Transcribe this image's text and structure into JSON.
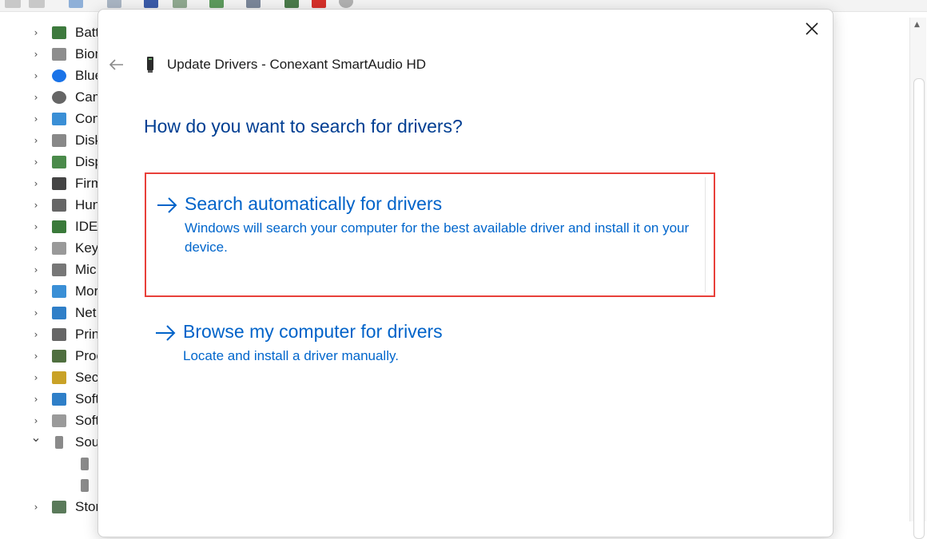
{
  "background": {
    "tree_items": [
      {
        "label": "Batt",
        "icon": "battery-icon",
        "expanded": false
      },
      {
        "label": "Biom",
        "icon": "fingerprint-icon",
        "expanded": false
      },
      {
        "label": "Blue",
        "icon": "bluetooth-icon",
        "expanded": false
      },
      {
        "label": "Cam",
        "icon": "camera-icon",
        "expanded": false
      },
      {
        "label": "Con",
        "icon": "computer-icon",
        "expanded": false
      },
      {
        "label": "Disk",
        "icon": "disk-drive-icon",
        "expanded": false
      },
      {
        "label": "Disp",
        "icon": "display-adapter-icon",
        "expanded": false
      },
      {
        "label": "Firm",
        "icon": "firmware-icon",
        "expanded": false
      },
      {
        "label": "Hun",
        "icon": "hid-icon",
        "expanded": false
      },
      {
        "label": "IDE",
        "icon": "ide-controller-icon",
        "expanded": false
      },
      {
        "label": "Key",
        "icon": "keyboard-icon",
        "expanded": false
      },
      {
        "label": "Mic",
        "icon": "mouse-icon",
        "expanded": false
      },
      {
        "label": "Mor",
        "icon": "monitor-icon",
        "expanded": false
      },
      {
        "label": "Net",
        "icon": "network-adapter-icon",
        "expanded": false
      },
      {
        "label": "Prin",
        "icon": "printer-icon",
        "expanded": false
      },
      {
        "label": "Proc",
        "icon": "processor-icon",
        "expanded": false
      },
      {
        "label": "Secu",
        "icon": "security-device-icon",
        "expanded": false
      },
      {
        "label": "Soft",
        "icon": "software-component-icon",
        "expanded": false
      },
      {
        "label": "Soft",
        "icon": "software-device-icon",
        "expanded": false
      },
      {
        "label": "Sou",
        "icon": "speaker-icon",
        "expanded": true
      },
      {
        "label": "",
        "icon": "speaker-icon",
        "child": true
      },
      {
        "label": "",
        "icon": "speaker-icon",
        "child": true
      },
      {
        "label": "Stor",
        "icon": "storage-controller-icon",
        "expanded": false
      }
    ]
  },
  "dialog": {
    "title": "Update Drivers - Conexant SmartAudio HD",
    "heading": "How do you want to search for drivers?",
    "options": [
      {
        "title": "Search automatically for drivers",
        "description": "Windows will search your computer for the best available driver and install it on your device."
      },
      {
        "title": "Browse my computer for drivers",
        "description": "Locate and install a driver manually."
      }
    ],
    "colors": {
      "heading": "#003e92",
      "link": "#0063c9",
      "highlight_border": "#e8403a"
    }
  }
}
